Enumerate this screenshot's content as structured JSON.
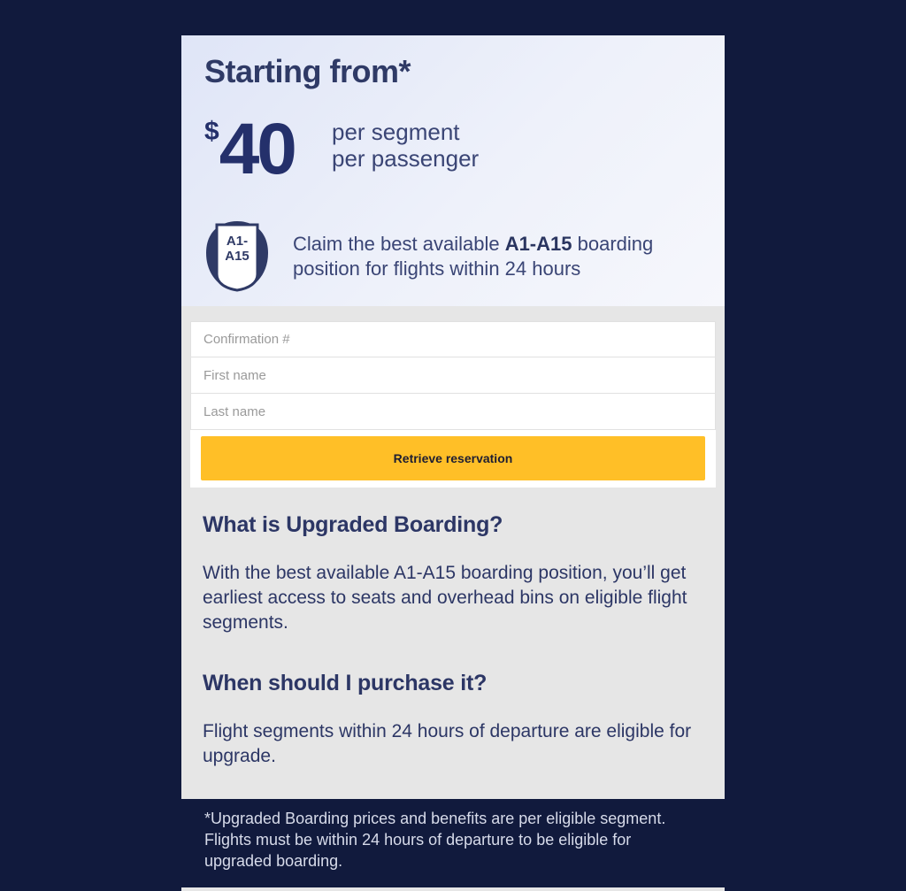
{
  "hero": {
    "title": "Starting from*",
    "currency": "$",
    "amount": "40",
    "unit_line1": "per segment",
    "unit_line2": "per passenger",
    "badge_line1": "A1-",
    "badge_line2": "A15",
    "claim_pre": "Claim the best available ",
    "claim_bold": "A1-A15",
    "claim_post": " boarding position for flights within 24 hours"
  },
  "form": {
    "confirmation_placeholder": "Confirmation #",
    "first_name_placeholder": "First name",
    "last_name_placeholder": "Last name",
    "submit_label": "Retrieve reservation"
  },
  "info": {
    "q1": "What is Upgraded Boarding?",
    "a1": "With the best available A1-A15 boarding position, you’ll get earliest access to seats and overhead bins on eligible flight segments.",
    "q2": "When should I purchase it?",
    "a2": "Flight segments within 24 hours of departure are eligible for upgrade."
  },
  "footnote": "*Upgraded Boarding prices and benefits are per eligible segment. Flights must be within 24 hours of departure to be eligible for upgraded boarding.",
  "colors": {
    "background": "#111a3d",
    "button": "#ffbf27",
    "text_navy": "#2c3665"
  }
}
